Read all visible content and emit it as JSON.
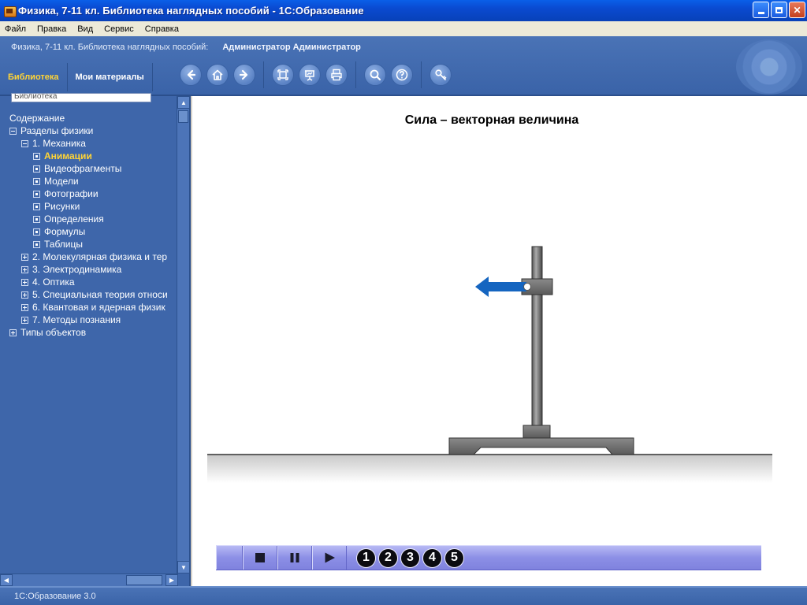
{
  "window": {
    "title": "Физика, 7-11 кл. Библиотека наглядных пособий - 1С:Образование"
  },
  "menu": [
    "Файл",
    "Правка",
    "Вид",
    "Сервис",
    "Справка"
  ],
  "header": {
    "product": "Физика, 7-11 кл. Библиотека наглядных пособий:",
    "user": "Администратор Администратор",
    "tabs": [
      "Библиотека",
      "Мои материалы"
    ]
  },
  "sidebar": {
    "select_value": "Библиотека",
    "tree": [
      {
        "label": "Содержание",
        "level": 0,
        "box": "none"
      },
      {
        "label": "Разделы физики",
        "level": 0,
        "box": "minus"
      },
      {
        "label": "1. Механика",
        "level": 1,
        "box": "minus"
      },
      {
        "label": "Анимации",
        "level": 2,
        "box": "leaf",
        "selected": true
      },
      {
        "label": "Видеофрагменты",
        "level": 2,
        "box": "leaf"
      },
      {
        "label": "Модели",
        "level": 2,
        "box": "leaf"
      },
      {
        "label": "Фотографии",
        "level": 2,
        "box": "leaf"
      },
      {
        "label": "Рисунки",
        "level": 2,
        "box": "leaf"
      },
      {
        "label": "Определения",
        "level": 2,
        "box": "leaf"
      },
      {
        "label": "Формулы",
        "level": 2,
        "box": "leaf"
      },
      {
        "label": "Таблицы",
        "level": 2,
        "box": "leaf"
      },
      {
        "label": "2. Молекулярная физика и тер",
        "level": 1,
        "box": "plus"
      },
      {
        "label": "3. Электродинамика",
        "level": 1,
        "box": "plus"
      },
      {
        "label": "4. Оптика",
        "level": 1,
        "box": "plus"
      },
      {
        "label": "5. Специальная теория относи",
        "level": 1,
        "box": "plus"
      },
      {
        "label": "6. Квантовая и ядерная физик",
        "level": 1,
        "box": "plus"
      },
      {
        "label": "7. Методы познания",
        "level": 1,
        "box": "plus"
      },
      {
        "label": "Типы объектов",
        "level": 0,
        "box": "plus"
      }
    ]
  },
  "content": {
    "title": "Сила – векторная величина",
    "steps": [
      "1",
      "2",
      "3",
      "4",
      "5"
    ]
  },
  "colors": {
    "accent_yellow": "#ffd436",
    "panel_blue": "#3e66aa",
    "force_arrow": "#1565c0"
  },
  "statusbar": {
    "text": "1С:Образование 3.0"
  }
}
